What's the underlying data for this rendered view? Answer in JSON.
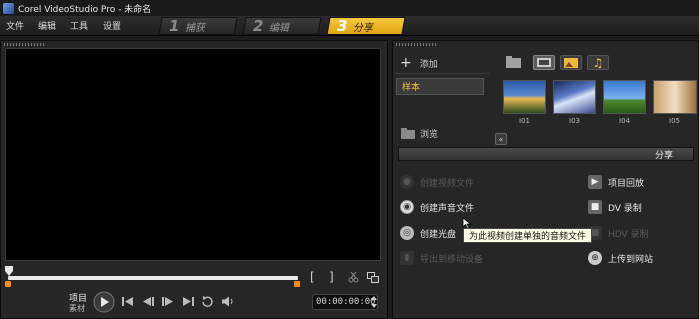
{
  "window": {
    "title": "Corel VideoStudio Pro - 未命名"
  },
  "menu": {
    "file": "文件",
    "edit": "编辑",
    "tools": "工具",
    "settings": "设置"
  },
  "steps": [
    {
      "num": "1",
      "label": "捕获"
    },
    {
      "num": "2",
      "label": "编辑"
    },
    {
      "num": "3",
      "label": "分享"
    }
  ],
  "player": {
    "mode_project": "项目",
    "mode_clip": "素材",
    "timecode": "00:00:00:00",
    "bracket_in": "[",
    "bracket_out": "]"
  },
  "library": {
    "add_label": "添加",
    "sample_tab": "样本",
    "browse_label": "浏览",
    "thumbnails": [
      {
        "label": "I01"
      },
      {
        "label": "I03"
      },
      {
        "label": "I04"
      },
      {
        "label": "I05"
      }
    ]
  },
  "share": {
    "header": "分享",
    "items": {
      "create_video": "创建视频文件",
      "create_audio": "创建声音文件",
      "create_disc": "创建光盘",
      "export_mobile": "导出到移动设备",
      "project_playback": "项目回放",
      "dv_record": "DV 录制",
      "hdv_record": "HDV 录制",
      "upload_web": "上传到网站"
    },
    "tooltip": "为此视频创建单独的音频文件"
  },
  "colors": {
    "accent": "#f2c346",
    "marker": "#ff8a1a"
  }
}
